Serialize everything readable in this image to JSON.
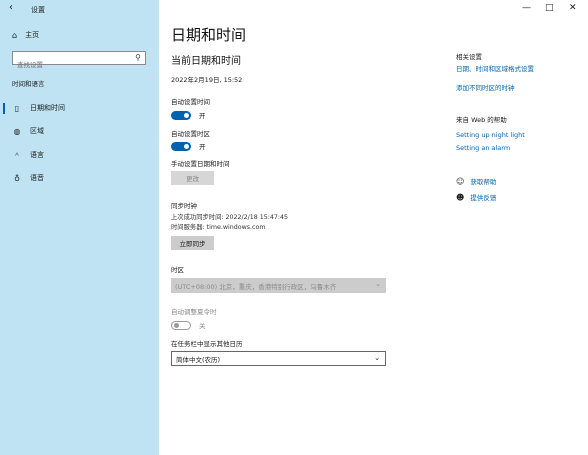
{
  "window": {
    "title": "设置",
    "back_glyph": "‹",
    "controls": {
      "minimize": "—",
      "maximize": "□",
      "close": "✕"
    }
  },
  "sidebar": {
    "home_label": "主页",
    "search_placeholder": "查找设置",
    "section_label": "时间和语言",
    "items": [
      {
        "label": "日期和时间",
        "icon": "clock-icon",
        "glyph": "▯",
        "active": true
      },
      {
        "label": "区域",
        "icon": "globe-icon",
        "glyph": "◍",
        "active": false
      },
      {
        "label": "语言",
        "icon": "language-icon",
        "glyph": "ᴬ",
        "active": false
      },
      {
        "label": "语音",
        "icon": "microphone-icon",
        "glyph": "♁",
        "active": false
      }
    ]
  },
  "main": {
    "title": "日期和时间",
    "subtitle": "当前日期和时间",
    "current_datetime": "2022年2月19日, 15:52",
    "auto_time": {
      "label": "自动设置时间",
      "state": "开",
      "on": true
    },
    "auto_timezone": {
      "label": "自动设置时区",
      "state": "开",
      "on": true
    },
    "manual": {
      "label": "手动设置日期和时间",
      "button": "更改"
    },
    "sync": {
      "title": "同步时钟",
      "last_sync": "上次成功同步时间: 2022/2/18 15:47:45",
      "server": "时间服务器: time.windows.com",
      "button": "立即同步"
    },
    "timezone": {
      "label": "时区",
      "value": "(UTC+08:00) 北京，重庆，香港特别行政区，乌鲁木齐"
    },
    "dst": {
      "label": "自动调整夏令时",
      "state": "关",
      "on": false
    },
    "calendar": {
      "label": "在任务栏中显示其他日历",
      "value": "简体中文(农历)"
    }
  },
  "right": {
    "related_title": "相关设置",
    "related_links": [
      "日期、时间和区域格式设置",
      "添加不同时区的时钟"
    ],
    "web_title": "来自 Web 的帮助",
    "web_links": [
      "Setting up night light",
      "Setting an alarm"
    ],
    "help": {
      "label": "获取帮助",
      "icon": "help-icon",
      "glyph": "☺"
    },
    "feedback": {
      "label": "提供反馈",
      "icon": "feedback-icon",
      "glyph": "☻"
    }
  },
  "colors": {
    "sidebar_bg": "#bfe3f3",
    "accent": "#0063b1"
  }
}
